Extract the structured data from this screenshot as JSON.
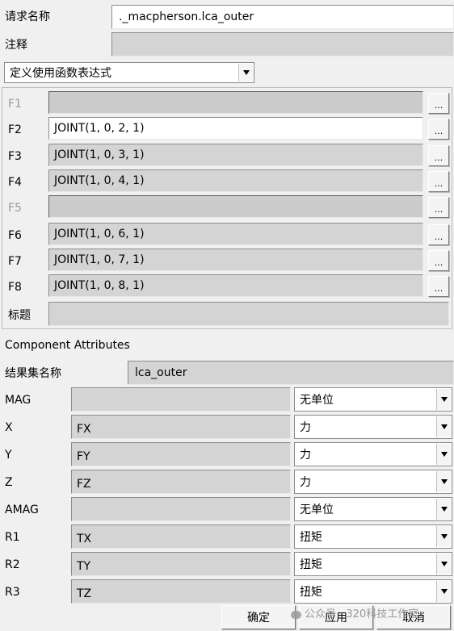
{
  "request": {
    "name_label": "请求名称",
    "name_value": "._macpherson.lca_outer",
    "comment_label": "注释",
    "comment_value": ""
  },
  "definition": {
    "selected": "定义使用函数表达式"
  },
  "functions": [
    {
      "label": "F1",
      "value": "",
      "enabled": false
    },
    {
      "label": "F2",
      "value": "JOINT(1, 0, 2, 1)",
      "enabled": true
    },
    {
      "label": "F3",
      "value": "JOINT(1, 0, 3, 1)",
      "enabled": true
    },
    {
      "label": "F4",
      "value": "JOINT(1, 0, 4, 1)",
      "enabled": true
    },
    {
      "label": "F5",
      "value": "",
      "enabled": false
    },
    {
      "label": "F6",
      "value": "JOINT(1, 0, 6, 1)",
      "enabled": true
    },
    {
      "label": "F7",
      "value": "JOINT(1, 0, 7, 1)",
      "enabled": true
    },
    {
      "label": "F8",
      "value": "JOINT(1, 0, 8, 1)",
      "enabled": true
    }
  ],
  "ellipsis_label": "...",
  "title_label": "标题",
  "title_value": "",
  "component_attributes": {
    "heading": "Component Attributes",
    "result_set_label": "结果集名称",
    "result_set_value": "lca_outer",
    "rows": [
      {
        "label": "MAG",
        "component": "",
        "unit": "无单位"
      },
      {
        "label": "X",
        "component": "FX",
        "unit": "力"
      },
      {
        "label": "Y",
        "component": "FY",
        "unit": "力"
      },
      {
        "label": "Z",
        "component": "FZ",
        "unit": "力"
      },
      {
        "label": "AMAG",
        "component": "",
        "unit": "无单位"
      },
      {
        "label": "R1",
        "component": "TX",
        "unit": "扭矩"
      },
      {
        "label": "R2",
        "component": "TY",
        "unit": "扭矩"
      },
      {
        "label": "R3",
        "component": "TZ",
        "unit": "扭矩"
      }
    ]
  },
  "buttons": {
    "ok": "确定",
    "apply": "应用",
    "cancel": "取消"
  },
  "watermark": "公众号 · 320科技工作室"
}
